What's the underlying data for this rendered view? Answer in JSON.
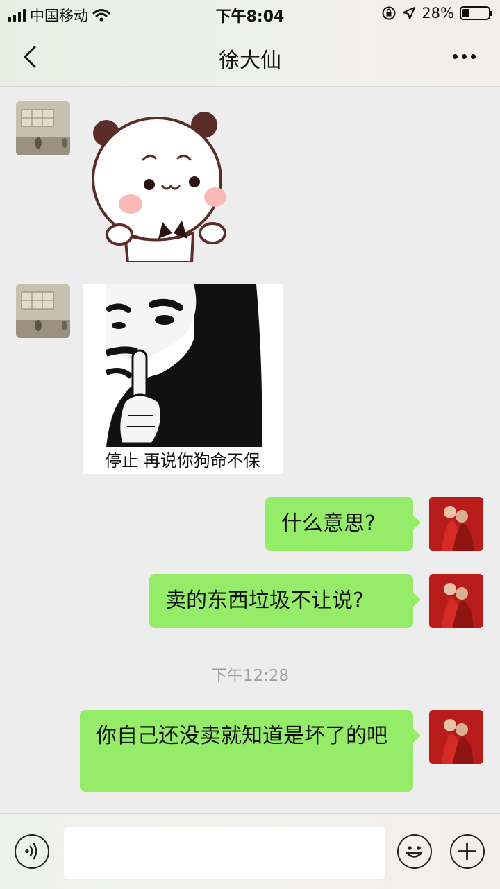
{
  "status_bar": {
    "carrier": "中国移动",
    "time": "下午8:04",
    "battery_percent": "28%",
    "battery_level": 0.28
  },
  "nav": {
    "title": "徐大仙",
    "back_icon": "chevron-left-icon",
    "more_icon": "more-dots-icon"
  },
  "messages": [
    {
      "side": "left",
      "type": "sticker",
      "avatar": "room-avatar"
    },
    {
      "side": "left",
      "type": "image",
      "caption": "停止 再说你狗命不保",
      "avatar": "room-avatar"
    },
    {
      "side": "right",
      "type": "text",
      "text": "什么意思?"
    },
    {
      "side": "right",
      "type": "text",
      "text": "卖的东西垃圾不让说?"
    },
    {
      "type": "timestamp",
      "text": "下午12:28"
    },
    {
      "side": "right",
      "type": "text",
      "text": "你自己还没卖就知道是坏了的吧"
    }
  ],
  "input_bar": {
    "voice_icon": "voice-icon",
    "emoji_icon": "emoji-icon",
    "plus_icon": "plus-icon",
    "value": ""
  },
  "colors": {
    "outgoing_bubble": "#95ec69",
    "chat_background": "#ededed"
  }
}
